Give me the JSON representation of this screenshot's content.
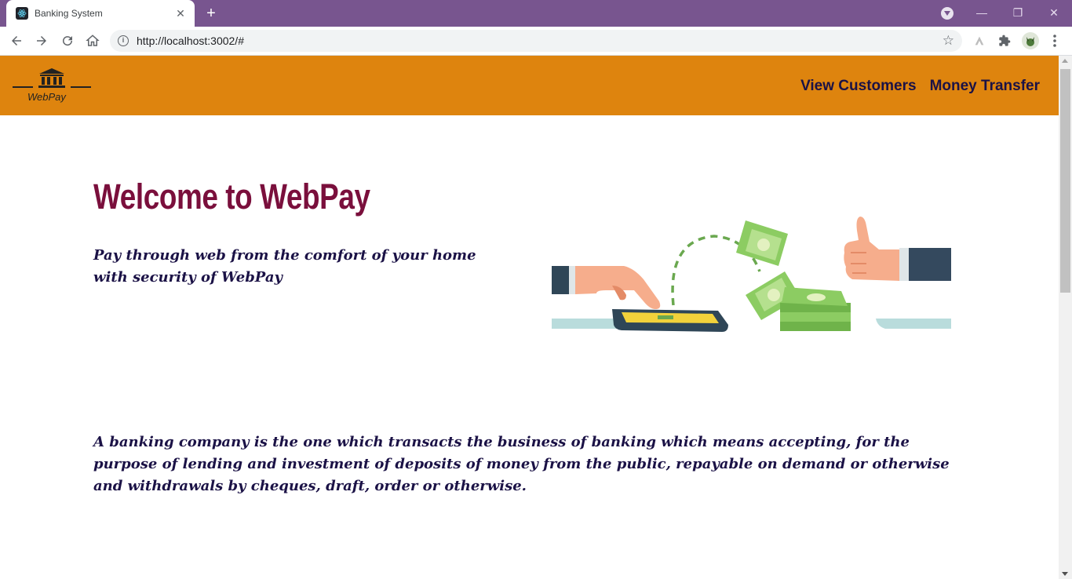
{
  "browser": {
    "tab_title": "Banking System",
    "tab_close": "✕",
    "newtab_label": "+",
    "url": "http://localhost:3002/#",
    "icons": [
      "react-favicon-icon",
      "back-icon",
      "forward-icon",
      "reload-icon",
      "home-icon",
      "info-icon",
      "star-icon",
      "extension-icon",
      "puzzle-icon",
      "profile-icon",
      "kebab-menu-icon"
    ],
    "minimize_glyph": "—",
    "restore_glyph": "❐",
    "close_glyph": "✕",
    "tabstrip_color": "#78558f"
  },
  "page": {
    "logo_text": "WebPay",
    "nav": {
      "view_customers": "View Customers",
      "money_transfer": "Money Transfer"
    },
    "hero": {
      "title": "Welcome to WebPay",
      "subtitle": "Pay through web from the comfort of your home with security of WebPay"
    },
    "body_text": "A banking company is the one which transacts the business of banking which means accepting, for the purpose of lending and investment of deposits of money from the public, repayable on demand or otherwise and withdrawals by cheques, draft, order or otherwise.",
    "colors": {
      "navbar": "#de840e",
      "title": "#7a0f3c",
      "text": "#1b1246"
    }
  }
}
